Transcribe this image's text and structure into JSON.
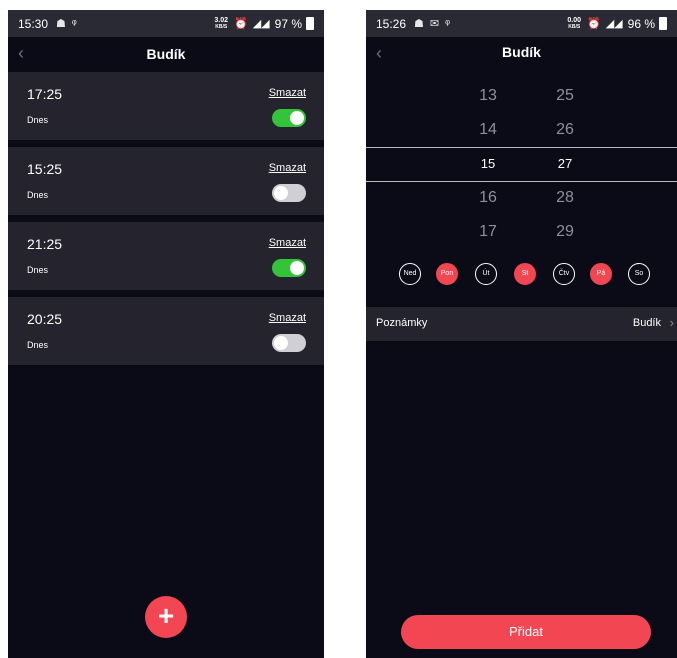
{
  "left_screen": {
    "status": {
      "time": "15:30",
      "net_speed_value": "3.02",
      "net_speed_unit": "KB/S",
      "battery": "97 %"
    },
    "header": {
      "back_icon": "chevron-left",
      "title": "Budík"
    },
    "alarms": [
      {
        "time": "17:25",
        "day": "Dnes",
        "delete_label": "Smazat",
        "enabled": true
      },
      {
        "time": "15:25",
        "day": "Dnes",
        "delete_label": "Smazat",
        "enabled": false
      },
      {
        "time": "21:25",
        "day": "Dnes",
        "delete_label": "Smazat",
        "enabled": true
      },
      {
        "time": "20:25",
        "day": "Dnes",
        "delete_label": "Smazat",
        "enabled": false
      }
    ],
    "fab": {
      "icon": "plus",
      "label": "+"
    }
  },
  "right_screen": {
    "status": {
      "time": "15:26",
      "net_speed_value": "0.00",
      "net_speed_unit": "KB/S",
      "battery": "96 %"
    },
    "header": {
      "back_icon": "chevron-left",
      "title": "Budík"
    },
    "picker": {
      "hours": [
        "13",
        "14",
        "15",
        "16",
        "17"
      ],
      "minutes": [
        "25",
        "26",
        "27",
        "28",
        "29"
      ],
      "selected_hour": "15",
      "selected_minute": "27"
    },
    "weekdays": [
      {
        "label": "Ned",
        "selected": false
      },
      {
        "label": "Pon",
        "selected": true
      },
      {
        "label": "Út",
        "selected": false
      },
      {
        "label": "St",
        "selected": true
      },
      {
        "label": "Čtv",
        "selected": false
      },
      {
        "label": "Pá",
        "selected": true
      },
      {
        "label": "So",
        "selected": false
      }
    ],
    "notes": {
      "label": "Poznámky",
      "value": "Budík"
    },
    "add_button": "Přidat"
  },
  "colors": {
    "background": "#0b0a17",
    "card": "#24232e",
    "accent": "#f24652",
    "toggle_on": "#34c43a",
    "toggle_off": "#cfcfd4"
  }
}
